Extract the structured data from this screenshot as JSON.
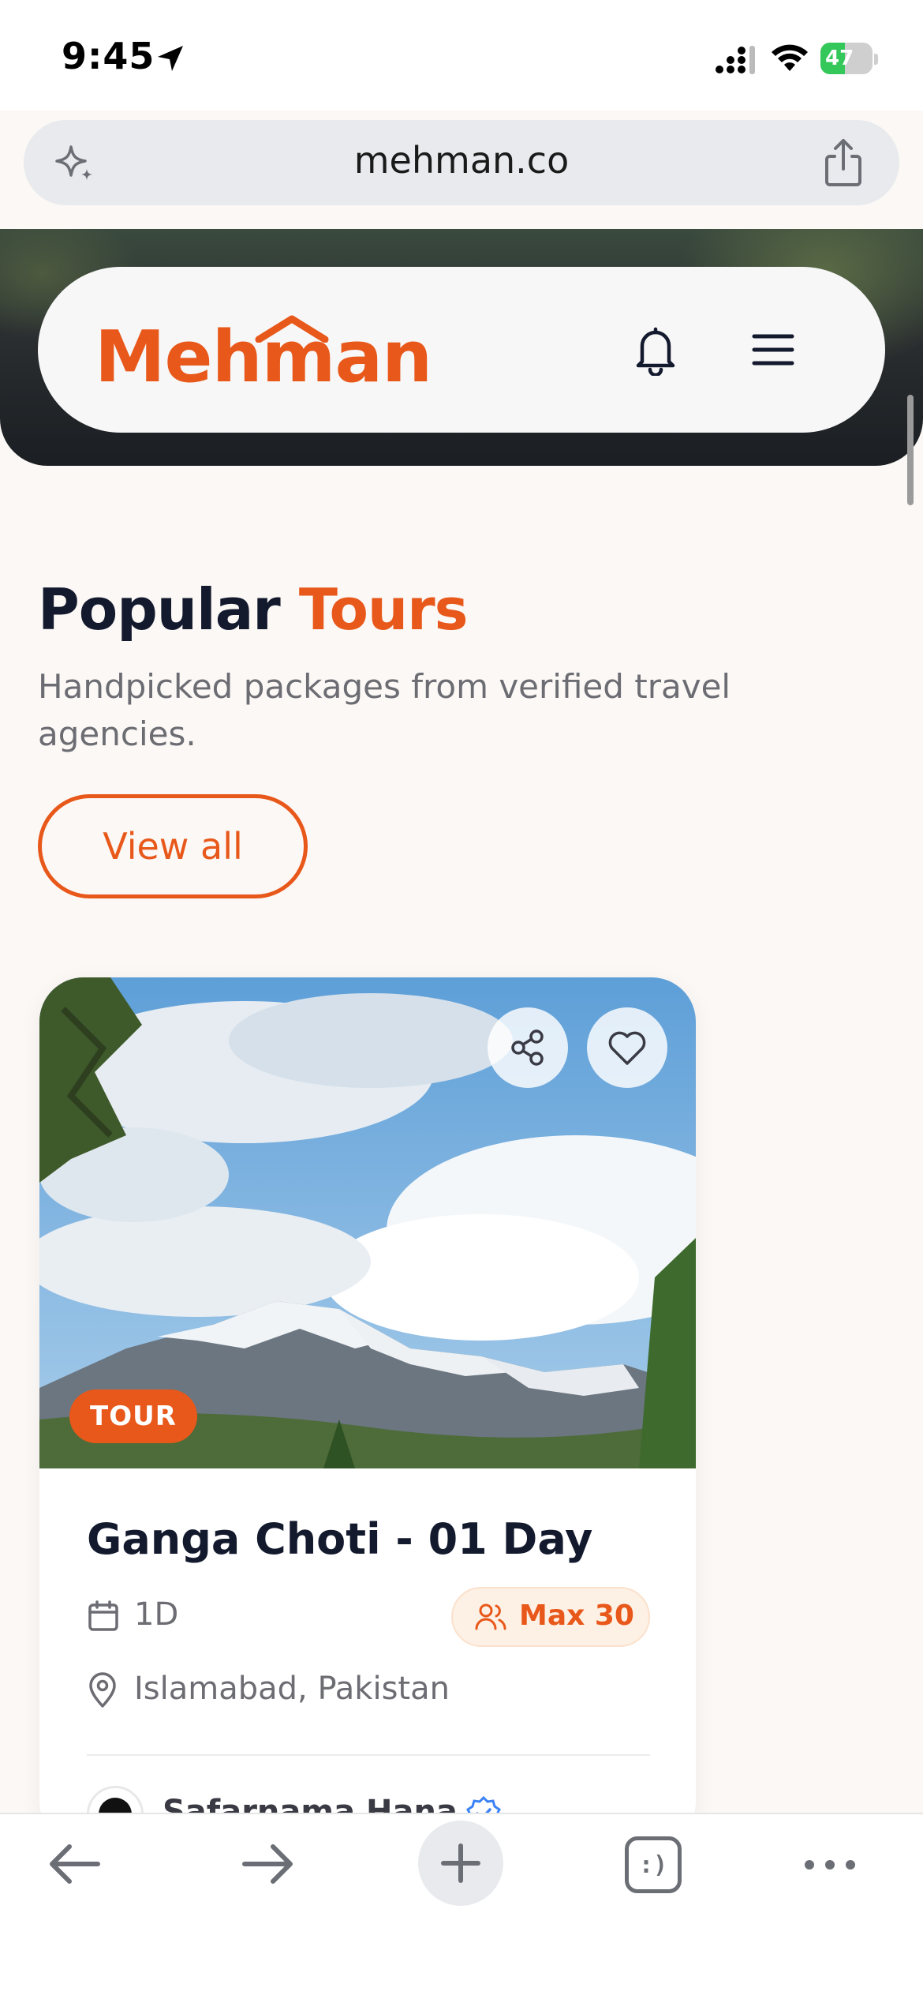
{
  "status_bar": {
    "time": "9:45",
    "battery": "47",
    "battery_level": 0.47,
    "icons": [
      "location-arrow-icon",
      "signal-icon",
      "wifi-icon",
      "battery-icon"
    ]
  },
  "browser": {
    "url": "mehman.co",
    "icons": [
      "sparkle-icon",
      "share-icon"
    ]
  },
  "header": {
    "logo": "Mehman",
    "icons": [
      "bell-icon",
      "menu-icon"
    ]
  },
  "section": {
    "title_main": "Popular",
    "title_accent": "Tours",
    "subtitle": "Handpicked packages from verified travel agencies.",
    "view_all": "View all"
  },
  "tour_card": {
    "badge": "TOUR",
    "title": "Ganga Choti - 01 Day",
    "duration": "1D",
    "capacity": "Max 30",
    "location": "Islamabad, Pakistan",
    "agency": "Safarnama Hana",
    "icons": [
      "share-icon",
      "heart-icon",
      "calendar-icon",
      "people-icon",
      "map-pin-icon",
      "verified-icon"
    ]
  },
  "toolbar": {
    "tabs_label": ":)",
    "icons": [
      "back-arrow-icon",
      "forward-arrow-icon",
      "plus-icon",
      "tabs-icon",
      "more-icon"
    ]
  },
  "colors": {
    "accent": "#e8581a",
    "heading": "#141a2e",
    "muted": "#6c6c73",
    "background": "#fbf8f5"
  }
}
